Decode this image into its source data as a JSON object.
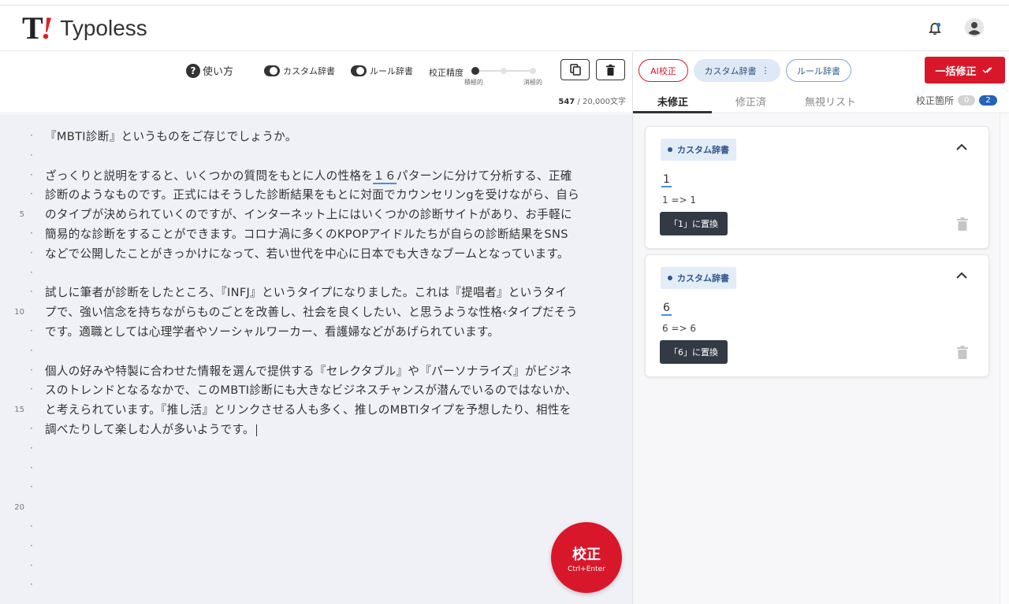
{
  "app": {
    "logo_mark": "T",
    "logo_bang": "!",
    "logo_text": "Typoless"
  },
  "header": {
    "bell_icon": "bell-icon",
    "avatar_icon": "user-avatar-icon"
  },
  "toolbar": {
    "help_label": "使い方",
    "custom_dict_label": "カスタム辞書",
    "rule_dict_label": "ルール辞書",
    "accuracy_label": "校正精度",
    "accuracy_level": 0,
    "accuracy_min_label": "積極的",
    "accuracy_max_label": "消極的",
    "copy_icon": "copy-icon",
    "delete_icon": "trash-icon",
    "char_count": "547",
    "char_limit": "/ 20,000文字"
  },
  "editor": {
    "line_numbers": {
      "5": "5",
      "10": "10",
      "15": "15",
      "20": "20"
    },
    "lines": [
      "『MBTI診断』というものをご存じでしょうか。",
      "",
      "ざっくりと説明をすると、いくつかの質問をもとに人の性格を",
      "診断のようなものです。正式にはそうした診断結果をもとに対面でカウンセリンgを受けながら、自ら",
      "のタイプが決められていくのですが、インターネット上にはいくつかの診断サイトがあり、お手軽に",
      "簡易的な診断をすることができます。コロナ渦に多くのKPOPアイドルたちが自らの診断結果をSNS",
      "などで公開したことがきっかけになって、若い世代を中心に日本でも大きなブームとなっています。",
      "",
      "試しに筆者が診断をしたところ、『INFJ』というタイプになりました。これは『提唱者』というタイ",
      "プで、強い信念を持ちながらものごとを改善し、社会を良くしたい、と思うような性格‹タイプだそう",
      "です。適職としては心理学者やソーシャルワーカー、看護婦などがあげられています。",
      "",
      "個人の好みや特製に合わせた情報を選んで提供する『セレクタブル』や『パーソナライズ』がビジネ",
      "スのトレンドとなるなかで、このMBTI診断にも大きなビジネスチャンスが潜んでいるのではないか、",
      "と考えられています。『推し活』とリンクさせる人も多く、推しのMBTIタイプを予想したり、相性を",
      "調べたりして楽しむ人が多いようです。"
    ],
    "line3_highlight": "１６",
    "line3_rest": "パターンに分けて分析する、正確",
    "submit_label": "校正",
    "submit_shortcut": "Ctrl+Enter"
  },
  "panel": {
    "ai_label": "AI校正",
    "custom_label": "カスタム辞書",
    "custom_more": "⋮",
    "rule_label": "ルール辞書",
    "fix_all_label": "一括修正",
    "tabs": [
      "未修正",
      "修正済",
      "無視リスト"
    ],
    "active_tab": "未修正",
    "spots_label": "校正箇所",
    "spots_fixed": "0",
    "spots_open": "2",
    "cards": [
      {
        "tag": "カスタム辞書",
        "word": "1",
        "rule": "1 => 1",
        "replace_label": "「1」に置換"
      },
      {
        "tag": "カスタム辞書",
        "word": "6",
        "rule": "6 => 6",
        "replace_label": "「6」に置換"
      }
    ]
  },
  "colors": {
    "brand_red": "#d8182a",
    "editor_bg": "#f0f1f7",
    "accent_blue": "#2463b5"
  }
}
